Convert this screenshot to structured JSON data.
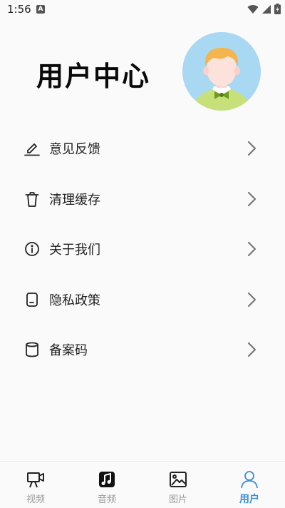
{
  "status_bar": {
    "time": "1:56",
    "indicator": "A",
    "icons": [
      "wifi-icon",
      "signal-icon",
      "battery-icon"
    ]
  },
  "header": {
    "title": "用户中心",
    "avatar_icon": "cartoon-boy-avatar"
  },
  "menu": {
    "items": [
      {
        "label": "意见反馈",
        "icon": "edit-pen-icon"
      },
      {
        "label": "清理缓存",
        "icon": "trash-icon"
      },
      {
        "label": "关于我们",
        "icon": "info-icon"
      },
      {
        "label": "隐私政策",
        "icon": "privacy-card-icon"
      },
      {
        "label": "备案码",
        "icon": "cylinder-icon"
      }
    ]
  },
  "tab_bar": {
    "tabs": [
      {
        "label": "视频",
        "icon": "video-camera-icon",
        "active": false
      },
      {
        "label": "音频",
        "icon": "music-note-icon",
        "active": false
      },
      {
        "label": "图片",
        "icon": "image-icon",
        "active": false
      },
      {
        "label": "用户",
        "icon": "user-icon",
        "active": true
      }
    ]
  },
  "colors": {
    "background": "#fafafa",
    "accent": "#3b8fd6",
    "avatar_bg": "#a9d8f2",
    "inactive_tab": "#9a9a9a"
  }
}
